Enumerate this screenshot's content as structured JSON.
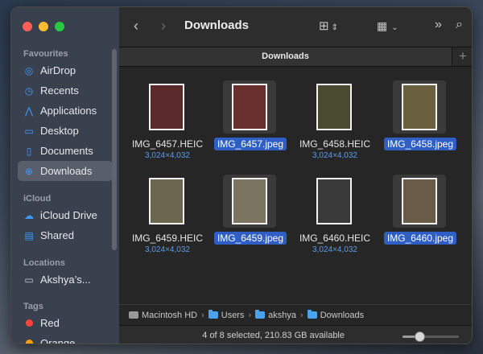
{
  "sidebar": {
    "favourites_header": "Favourites",
    "favourites": [
      {
        "label": "AirDrop",
        "icon": "airdrop-icon"
      },
      {
        "label": "Recents",
        "icon": "clock-icon"
      },
      {
        "label": "Applications",
        "icon": "applications-icon"
      },
      {
        "label": "Desktop",
        "icon": "desktop-icon"
      },
      {
        "label": "Documents",
        "icon": "document-icon"
      },
      {
        "label": "Downloads",
        "icon": "download-icon",
        "active": true
      }
    ],
    "icloud_header": "iCloud",
    "icloud": [
      {
        "label": "iCloud Drive",
        "icon": "cloud-icon"
      },
      {
        "label": "Shared",
        "icon": "shared-folder-icon"
      }
    ],
    "locations_header": "Locations",
    "locations": [
      {
        "label": "Akshya’s...",
        "icon": "laptop-icon"
      }
    ],
    "tags_header": "Tags",
    "tags": [
      {
        "label": "Red",
        "color": "#ff453a"
      },
      {
        "label": "Orange",
        "color": "#ff9f0a"
      }
    ]
  },
  "toolbar": {
    "title": "Downloads",
    "back_icon": "chevron-left-icon",
    "forward_icon": "chevron-right-icon"
  },
  "tab": {
    "label": "Downloads"
  },
  "files": [
    {
      "name": "IMG_6457.HEIC",
      "dims": "3,024×4,032",
      "selected": false,
      "color": "#5a2a2a"
    },
    {
      "name": "IMG_6457.jpeg",
      "dims": "",
      "selected": true,
      "color": "#6a3030"
    },
    {
      "name": "IMG_6458.HEIC",
      "dims": "3,024×4,032",
      "selected": false,
      "color": "#4a4a30"
    },
    {
      "name": "IMG_6458.jpeg",
      "dims": "",
      "selected": true,
      "color": "#6a6040"
    },
    {
      "name": "IMG_6459.HEIC",
      "dims": "3,024×4,032",
      "selected": false,
      "color": "#6a6650"
    },
    {
      "name": "IMG_6459.jpeg",
      "dims": "",
      "selected": true,
      "color": "#7a7460"
    },
    {
      "name": "IMG_6460.HEIC",
      "dims": "3,024×4,032",
      "selected": false,
      "color": "#3a3a3a"
    },
    {
      "name": "IMG_6460.jpeg",
      "dims": "",
      "selected": true,
      "color": "#6a5a48"
    }
  ],
  "path": [
    "Macintosh HD",
    "Users",
    "akshya",
    "Downloads"
  ],
  "status": {
    "text": "4 of 8 selected, 210.83 GB available",
    "zoom": 0.3
  }
}
